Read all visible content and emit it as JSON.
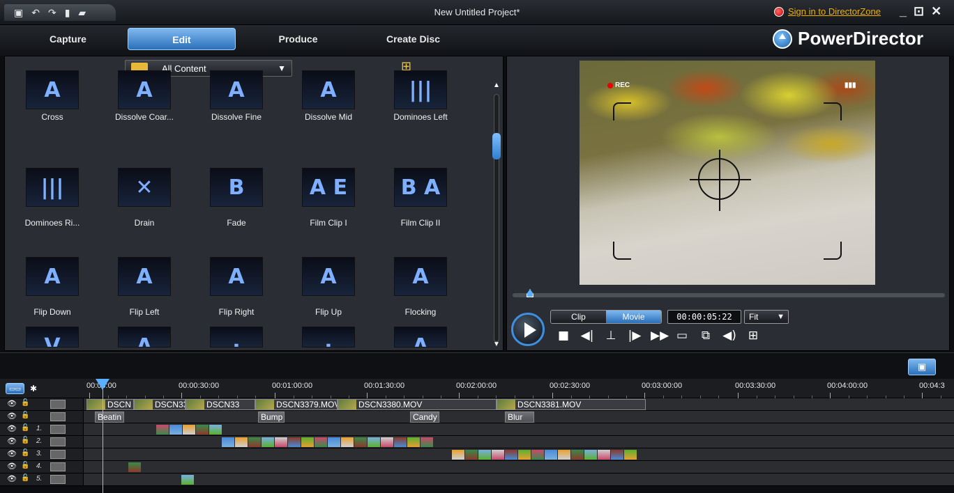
{
  "window": {
    "title": "New Untitled Project*",
    "sign_in": "Sign in to DirectorZone",
    "controls": [
      "_",
      "⊡",
      "✕"
    ]
  },
  "quick_access": [
    "save-icon",
    "undo-icon",
    "redo-icon",
    "new-icon",
    "open-icon"
  ],
  "nav": {
    "tabs": [
      {
        "label": "Capture",
        "active": false
      },
      {
        "label": "Edit",
        "active": true
      },
      {
        "label": "Produce",
        "active": false
      },
      {
        "label": "Create Disc",
        "active": false
      }
    ],
    "brand": "PowerDirector"
  },
  "library": {
    "content_filter": "All Content",
    "tiles": [
      {
        "label": "Cross",
        "glyph": "A"
      },
      {
        "label": "Dissolve Coar...",
        "glyph": "A"
      },
      {
        "label": "Dissolve Fine",
        "glyph": "A"
      },
      {
        "label": "Dissolve Mid",
        "glyph": "A"
      },
      {
        "label": "Dominoes Left",
        "glyph": "|||"
      },
      {
        "label": "Dominoes Ri...",
        "glyph": "|||"
      },
      {
        "label": "Drain",
        "glyph": "✕"
      },
      {
        "label": "Fade",
        "glyph": "B"
      },
      {
        "label": "Film Clip I",
        "glyph": "A E"
      },
      {
        "label": "Film Clip II",
        "glyph": "B A"
      },
      {
        "label": "Flip Down",
        "glyph": "A"
      },
      {
        "label": "Flip Left",
        "glyph": "A"
      },
      {
        "label": "Flip Right",
        "glyph": "A"
      },
      {
        "label": "Flip Up",
        "glyph": "A"
      },
      {
        "label": "Flocking",
        "glyph": "A"
      },
      {
        "label": "",
        "glyph": "V"
      },
      {
        "label": "",
        "glyph": "A"
      },
      {
        "label": "",
        "glyph": "·"
      },
      {
        "label": "",
        "glyph": "·"
      },
      {
        "label": "",
        "glyph": "A"
      }
    ]
  },
  "preview": {
    "overlay_rec": "REC",
    "mode_clip": "Clip",
    "mode_movie": "Movie",
    "active_mode": "Movie",
    "timecode": "00:00:05:22",
    "fit": "Fit",
    "controls": [
      "stop-icon",
      "prev-frame-icon",
      "split-icon",
      "next-frame-icon",
      "fast-forward-icon",
      "snapshot-icon",
      "fullscreen-icon",
      "volume-icon",
      "settings-icon"
    ]
  },
  "timeline": {
    "ruler_labels": [
      "00:00:00",
      "00:00:30:00",
      "00:01:00:00",
      "00:01:30:00",
      "00:02:00:00",
      "00:02:30:00",
      "00:03:00:00",
      "00:03:30:00",
      "00:04:00:00",
      "00:04:3"
    ],
    "video_clips": [
      "DSCN",
      "DSCN33",
      "DSCN33",
      "DSCN3379.MOV",
      "DSCN3380.MOV",
      "DSCN3381.MOV"
    ],
    "transitions": [
      "Beatin",
      "Bump",
      "Candy",
      "Blur"
    ],
    "pip_tracks": [
      "1.",
      "2.",
      "3.",
      "4.",
      "5."
    ]
  }
}
